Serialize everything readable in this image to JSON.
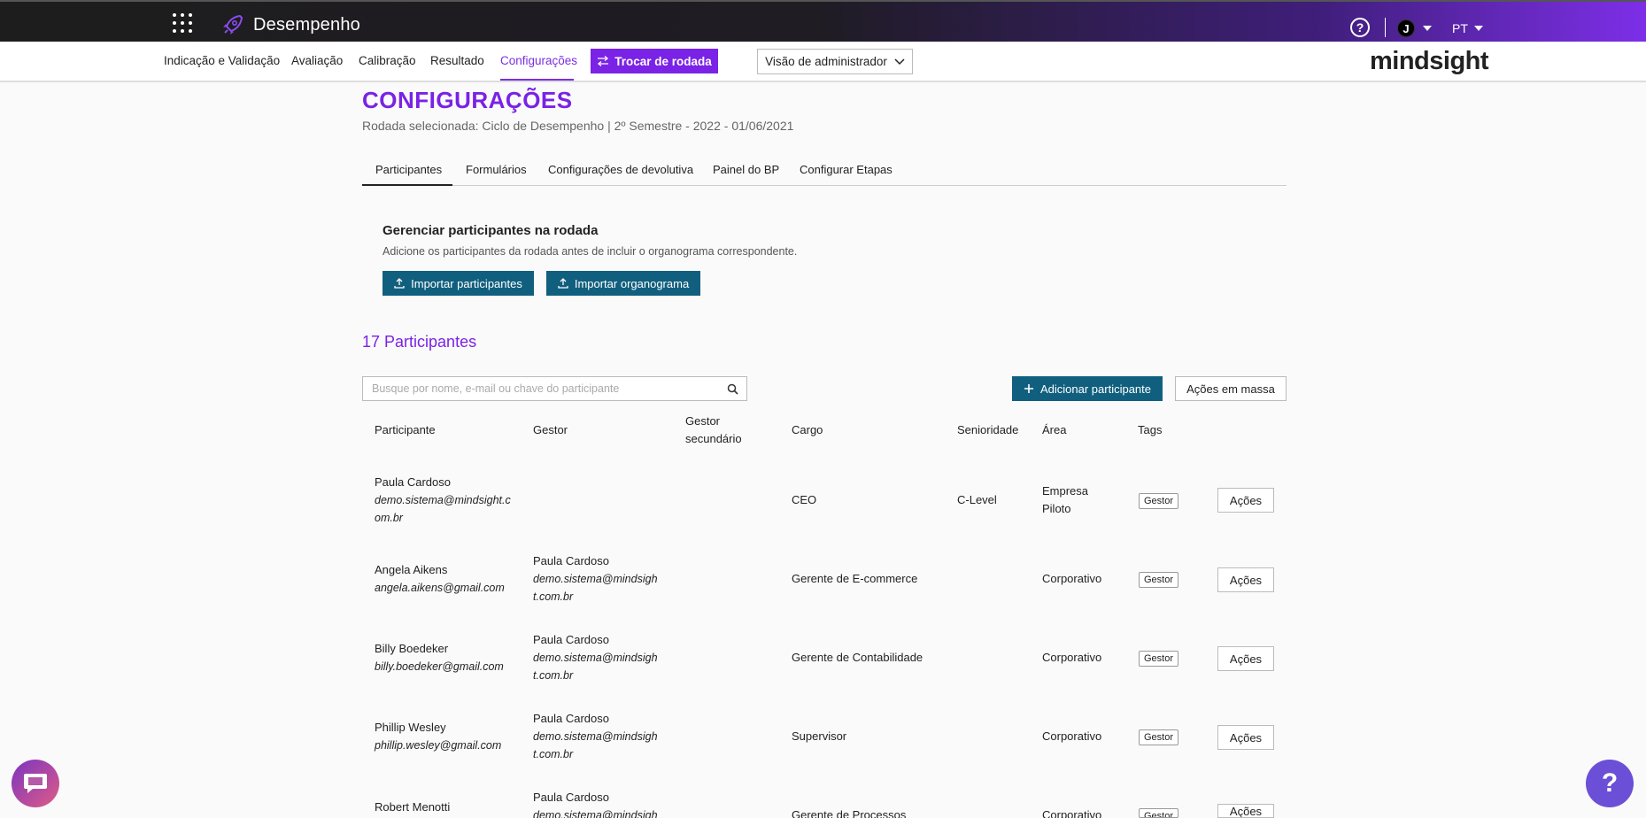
{
  "app": {
    "title": "Desempenho",
    "brand": "mindsight",
    "language": "PT",
    "user_initial": "J",
    "accent": "#7a22e6",
    "button_color": "#115f7e"
  },
  "nav": {
    "items": [
      "Indicação e Validação",
      "Avaliação",
      "Calibração",
      "Resultado",
      "Configurações"
    ],
    "active": "Configurações",
    "trocar_label": "Trocar de rodada",
    "view_select": "Visão de administrador"
  },
  "page": {
    "title": "CONFIGURAÇÕES",
    "subtitle": "Rodada selecionada: Ciclo de Desempenho | 2º Semestre - 2022 - 01/06/2021"
  },
  "tabs": [
    "Participantes",
    "Formulários",
    "Configurações de devolutiva",
    "Painel do BP",
    "Configurar Etapas"
  ],
  "manage": {
    "title": "Gerenciar participantes na rodada",
    "description": "Adicione os participantes da rodada antes de incluir o organograma correspondente.",
    "import_participants": "Importar participantes",
    "import_org": "Importar organograma"
  },
  "participants": {
    "count_label": "17 Participantes",
    "search_placeholder": "Busque por nome, e-mail ou chave do participante",
    "add_label": "Adicionar participante",
    "mass_label": "Ações em massa",
    "columns": [
      "Participante",
      "Gestor",
      "Gestor secundário",
      "Cargo",
      "Senioridade",
      "Área",
      "Tags"
    ],
    "rows": [
      {
        "name": "Paula Cardoso",
        "email": "demo.sistema@mindsight.com.br",
        "manager_name": "",
        "manager_email": "",
        "cargo": "CEO",
        "senioridade": "C-Level",
        "area": "Empresa Piloto",
        "tag": "Gestor",
        "action": "Ações"
      },
      {
        "name": "Angela Aikens",
        "email": "angela.aikens@gmail.com",
        "manager_name": "Paula Cardoso",
        "manager_email": "demo.sistema@mindsight.com.br",
        "cargo": "Gerente de E-commerce",
        "senioridade": "",
        "area": "Corporativo",
        "tag": "Gestor",
        "action": "Ações"
      },
      {
        "name": "Billy Boedeker",
        "email": "billy.boedeker@gmail.com",
        "manager_name": "Paula Cardoso",
        "manager_email": "demo.sistema@mindsight.com.br",
        "cargo": "Gerente de Contabilidade",
        "senioridade": "",
        "area": "Corporativo",
        "tag": "Gestor",
        "action": "Ações"
      },
      {
        "name": "Phillip Wesley",
        "email": "phillip.wesley@gmail.com",
        "manager_name": "Paula Cardoso",
        "manager_email": "demo.sistema@mindsight.com.br",
        "cargo": "Supervisor",
        "senioridade": "",
        "area": "Corporativo",
        "tag": "Gestor",
        "action": "Ações"
      },
      {
        "name": "Robert Menotti",
        "email": "",
        "manager_name": "Paula Cardoso",
        "manager_email": "demo.sistema@mindsight.com.br",
        "cargo": "Gerente de Processos",
        "senioridade": "",
        "area": "Corporativo",
        "tag": "Gestor",
        "action": "Ações"
      }
    ]
  },
  "icons": {
    "apps": "grid-icon",
    "logo": "rocket-icon",
    "help": "help-icon",
    "search": "search-icon",
    "upload": "upload-icon",
    "swap": "swap-icon",
    "plus": "plus-icon",
    "chat": "chat-icon"
  }
}
